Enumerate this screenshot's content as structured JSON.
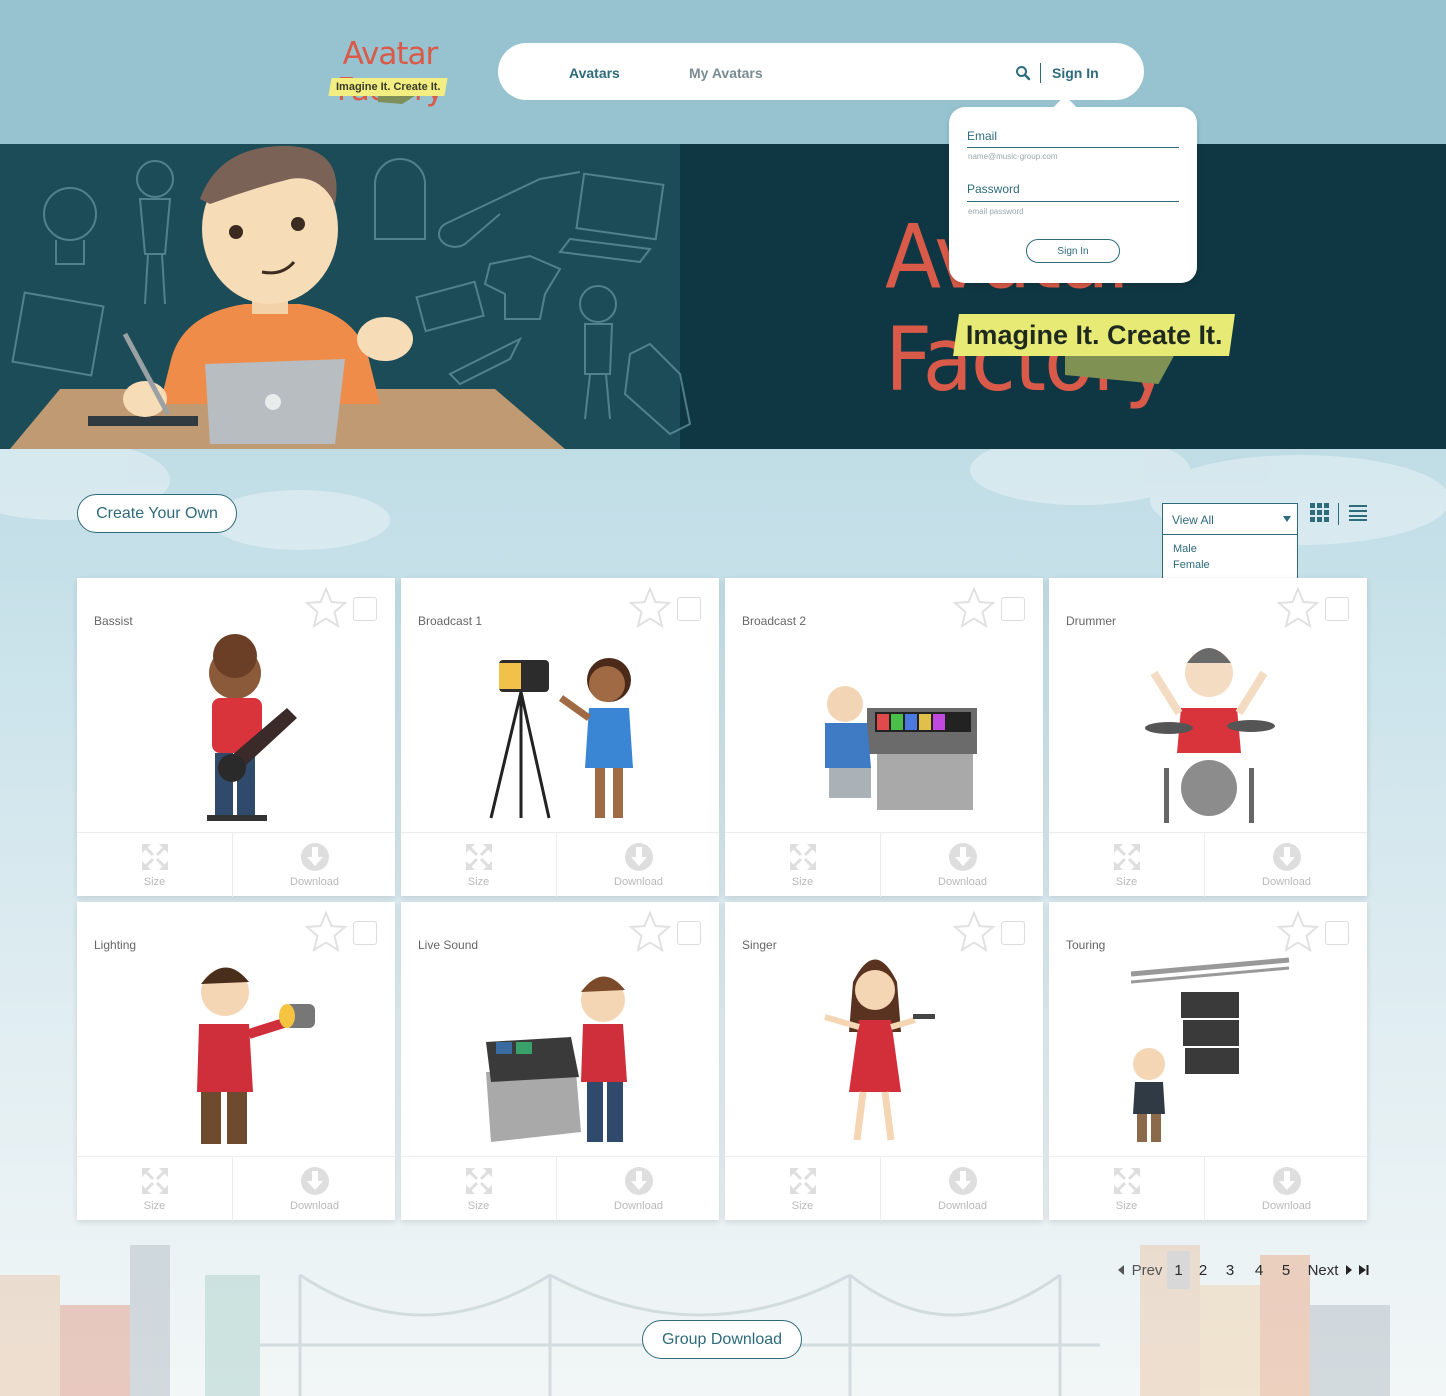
{
  "brand": {
    "title": "Avatar Factory",
    "tagline": "Imagine It. Create It."
  },
  "nav": {
    "avatars": "Avatars",
    "my_avatars": "My Avatars",
    "sign_in": "Sign In"
  },
  "hero": {
    "title": "Avatar Factory",
    "tagline": "Imagine It. Create It."
  },
  "signin_popup": {
    "email_label": "Email",
    "email_placeholder": "name@music-group.com",
    "password_label": "Password",
    "password_placeholder": "email password",
    "button": "Sign In"
  },
  "toolbar": {
    "create_button": "Create Your Own",
    "filter_selected": "View All",
    "filter_options": [
      "Male",
      "Female"
    ]
  },
  "cards": [
    {
      "label": "Bassist",
      "size_label": "Size",
      "download_label": "Download"
    },
    {
      "label": "Broadcast 1",
      "size_label": "Size",
      "download_label": "Download"
    },
    {
      "label": "Broadcast 2",
      "size_label": "Size",
      "download_label": "Download"
    },
    {
      "label": "Drummer",
      "size_label": "Size",
      "download_label": "Download"
    },
    {
      "label": "Lighting",
      "size_label": "Size",
      "download_label": "Download"
    },
    {
      "label": "Live Sound",
      "size_label": "Size",
      "download_label": "Download"
    },
    {
      "label": "Singer",
      "size_label": "Size",
      "download_label": "Download"
    },
    {
      "label": "Touring",
      "size_label": "Size",
      "download_label": "Download"
    }
  ],
  "pagination": {
    "prev": "Prev",
    "pages": [
      "1",
      "2",
      "3",
      "4",
      "5"
    ],
    "current": "1",
    "next": "Next"
  },
  "group_download": "Group Download",
  "colors": {
    "accent": "#2e6b7b",
    "brand_red": "#d95a48",
    "ribbon_yellow": "#e8ea76",
    "hero_bg": "#0f3743",
    "header_bg": "#97c3d1"
  }
}
